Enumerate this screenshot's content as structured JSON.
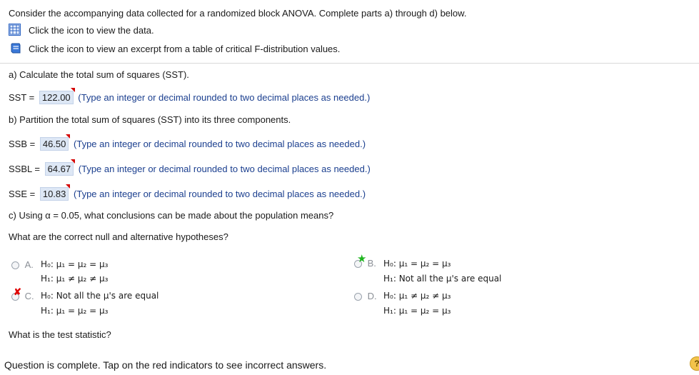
{
  "intro": "Consider the accompanying data collected for a randomized block ANOVA. Complete parts a) through d) below.",
  "links": {
    "data": "Click the icon to view the data.",
    "table": "Click the icon to view an excerpt from a table of critical F-distribution values."
  },
  "part_a": {
    "question": "a) Calculate the total sum of squares (SST).",
    "label": "SST =",
    "value": "122.00",
    "hint": "(Type an integer or decimal rounded to two decimal places as needed.)"
  },
  "part_b": {
    "question": "b) Partition the total sum of squares (SST) into its three components.",
    "ssb": {
      "label": "SSB =",
      "value": "46.50",
      "hint": "(Type an integer or decimal rounded to two decimal places as needed.)"
    },
    "ssbl": {
      "label": "SSBL =",
      "value": "64.67",
      "hint": "(Type an integer or decimal rounded to two decimal places as needed.)"
    },
    "sse": {
      "label": "SSE =",
      "value": "10.83",
      "hint": "(Type an integer or decimal rounded to two decimal places as needed.)"
    }
  },
  "part_c": {
    "question": "c) Using α = 0.05, what conclusions can be made about the population means?",
    "prompt": "What are the correct null and alternative hypotheses?",
    "options": [
      {
        "letter": "A.",
        "h0": "H₀: μ₁ = μ₂ = μ₃",
        "h1": "H₁: μ₁ ≠ μ₂ ≠ μ₃",
        "state": "unselected"
      },
      {
        "letter": "B.",
        "h0": "H₀: μ₁ = μ₂ = μ₃",
        "h1": "H₁: Not all the μ's are equal",
        "state": "correct"
      },
      {
        "letter": "C.",
        "h0": "H₀: Not all the μ's are equal",
        "h1": "H₁: μ₁ = μ₂ = μ₃",
        "state": "incorrect"
      },
      {
        "letter": "D.",
        "h0": "H₀: μ₁ ≠ μ₂ ≠ μ₃",
        "h1": "H₁: μ₁ = μ₂ = μ₃",
        "state": "unselected"
      }
    ],
    "next_prompt": "What is the test statistic?"
  },
  "footer": {
    "status": "Question is complete. Tap on the red indicators to see incorrect answers.",
    "help": "?"
  },
  "colors": {
    "correct_star": "#1fb51f",
    "incorrect_x": "#e00000",
    "hint_text": "#1b3f8f",
    "answer_bg": "#dde7f5"
  }
}
